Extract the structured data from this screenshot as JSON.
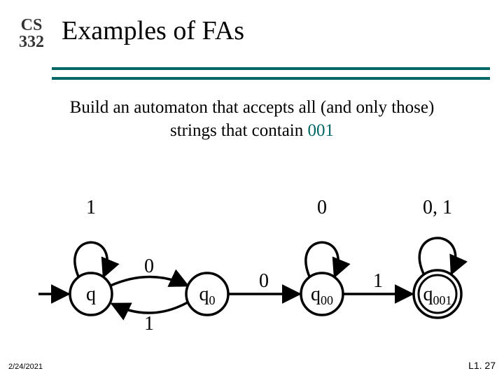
{
  "course": {
    "dept": "CS",
    "number": "332"
  },
  "title": "Examples of FAs",
  "prompt": {
    "line1": "Build an automaton that accepts all (and only those)",
    "line2_pre": "strings that contain ",
    "pattern": "001"
  },
  "footer": {
    "date": "2/24/2021",
    "slide": "L1. 27"
  },
  "fa": {
    "states": {
      "q": {
        "label": "q",
        "sub": "",
        "accepting": false
      },
      "q0": {
        "label": "q",
        "sub": "0",
        "accepting": false
      },
      "q00": {
        "label": "q",
        "sub": "00",
        "accepting": false
      },
      "q001": {
        "label": "q",
        "sub": "001",
        "accepting": true
      }
    },
    "start": "q",
    "transitions": {
      "q_self": "1",
      "q_to_q0": "0",
      "q0_to_q": "1",
      "q0_to_q00": "0",
      "q00_self": "0",
      "q00_to_q001": "1",
      "q001_self": "0, 1"
    }
  }
}
